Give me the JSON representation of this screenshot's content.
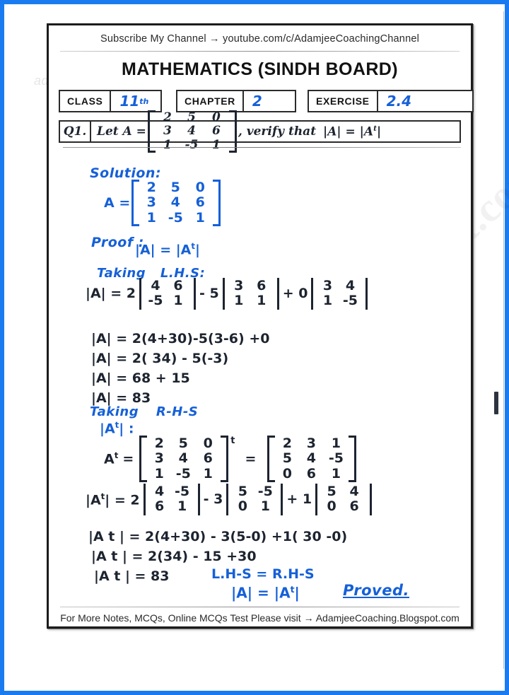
{
  "page": {
    "frame_color": "#1a7bf0",
    "ink_blue": "#1560d8",
    "ink_dark": "#1d2430"
  },
  "watermarks": {
    "diagonal": "AdamjeeCoaching.Blogspot.com",
    "horizontal": "adamjeecoaching.blogspot.com"
  },
  "header": {
    "subscribe": "Subscribe My Channel → youtube.com/c/AdamjeeCoachingChannel",
    "title": "MATHEMATICS (SINDH BOARD)",
    "meta": [
      {
        "label": "CLASS",
        "value": "11",
        "superscript": "th"
      },
      {
        "label": "CHAPTER",
        "value": "2",
        "superscript": ""
      },
      {
        "label": "EXERCISE",
        "value": "2.4",
        "superscript": ""
      }
    ]
  },
  "question": {
    "number": "Q1.",
    "text_before": "Let  A =",
    "matrix": [
      [
        "2",
        "5",
        "0"
      ],
      [
        "3",
        "4",
        "6"
      ],
      [
        "1",
        "-5",
        "1"
      ]
    ],
    "text_after": ", verify  that",
    "claim": "|A| = |A",
    "claim_sup": "t",
    "claim_end": "|"
  },
  "solution": {
    "solution_label": "Solution:",
    "a_label": "A =",
    "a_matrix": [
      [
        "2",
        "5",
        "0"
      ],
      [
        "3",
        "4",
        "6"
      ],
      [
        "1",
        "-5",
        "1"
      ]
    ],
    "proof_label": "Proof :",
    "proof_statement_left": "|A| = |A",
    "proof_statement_sup": "t",
    "proof_statement_right": "|",
    "lhs_label_1": "Taking",
    "lhs_label_2": "L.H.S:",
    "lhs_expansion": {
      "lead": "|A| = 2",
      "minor1": [
        [
          "4",
          "6"
        ],
        [
          "-5",
          "1"
        ]
      ],
      "op1": "- 5",
      "minor2": [
        [
          "3",
          "6"
        ],
        [
          "1",
          "1"
        ]
      ],
      "op2": "+ 0",
      "minor3": [
        [
          "3",
          "4"
        ],
        [
          "1",
          "-5"
        ]
      ]
    },
    "lhs_steps": [
      "|A| = 2(4+30)-5(3-6) +0",
      "|A| = 2( 34) - 5(-3)",
      "|A| = 68 + 15",
      "|A| = 83"
    ],
    "rhs_label_1": "Taking",
    "rhs_label_2": "R-H-S",
    "rhs_sub_left": "|A",
    "rhs_sub_sup": "t",
    "rhs_sub_right": "| :",
    "at_label_left": "A",
    "at_label_sup": "t",
    "at_label_eq": "=",
    "at_source_matrix": [
      [
        "2",
        "5",
        "0"
      ],
      [
        "3",
        "4",
        "6"
      ],
      [
        "1",
        "-5",
        "1"
      ]
    ],
    "at_transpose_mark": "t",
    "at_equals": "=",
    "at_result_matrix": [
      [
        "2",
        "3",
        "1"
      ],
      [
        "5",
        "4",
        "-5"
      ],
      [
        "0",
        "6",
        "1"
      ]
    ],
    "rhs_expansion": {
      "lead_left": "|A",
      "lead_sup": "t",
      "lead_right": "| = 2",
      "minor1": [
        [
          "4",
          "-5"
        ],
        [
          "6",
          "1"
        ]
      ],
      "op1": "- 3",
      "minor2": [
        [
          "5",
          "-5"
        ],
        [
          "0",
          "1"
        ]
      ],
      "op2": "+ 1",
      "minor3": [
        [
          "5",
          "4"
        ],
        [
          "0",
          "6"
        ]
      ]
    },
    "rhs_steps": [
      "|A t | = 2(4+30) - 3(5-0) +1( 30 -0)",
      "|A t | = 2(34) - 15 +30",
      "|A t | = 83"
    ],
    "conclusion": {
      "line1": "L.H-S = R.H-S",
      "line2_left": "|A| = |A",
      "line2_sup": "t",
      "line2_right": "|",
      "proved": "Proved."
    }
  },
  "footer": {
    "text": "For More Notes, MCQs, Online MCQs Test Please visit → AdamjeeCoaching.Blogspot.com"
  }
}
